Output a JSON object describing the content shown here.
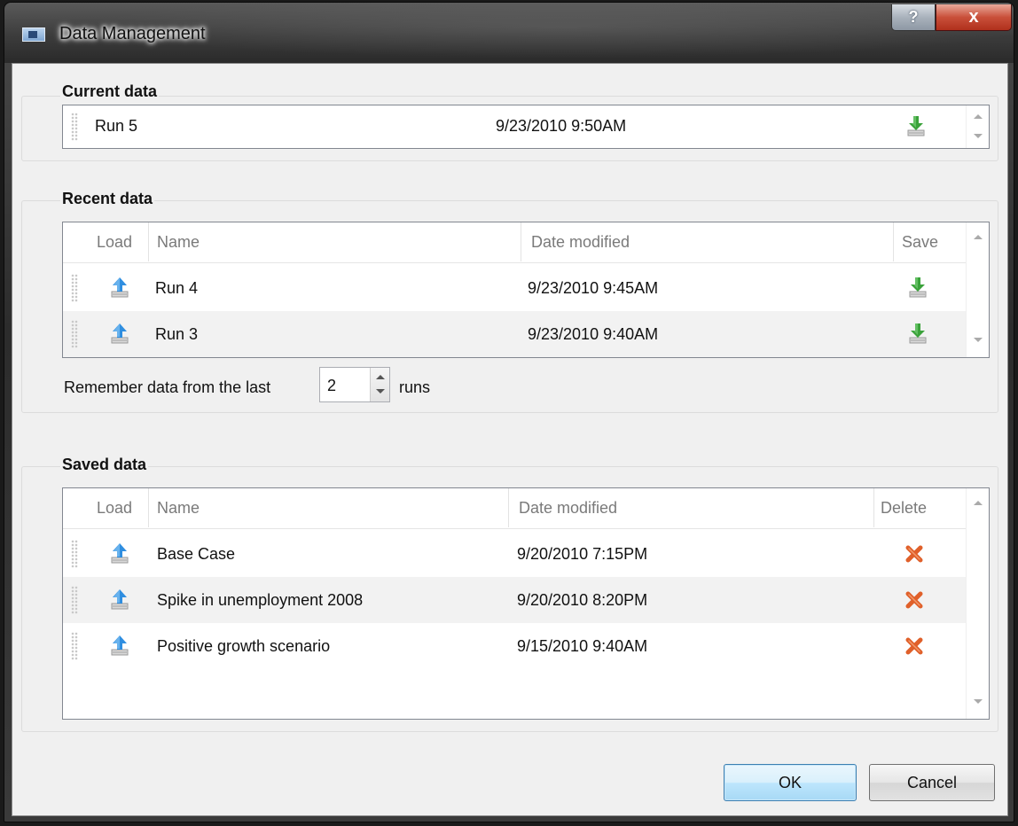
{
  "window": {
    "title": "Data Management",
    "help_glyph": "?",
    "close_glyph": "x"
  },
  "current": {
    "title": "Current data",
    "row": {
      "name": "Run 5",
      "date": "9/23/2010 9:50AM",
      "action_icon": "save-download-icon"
    }
  },
  "recent": {
    "title": "Recent data",
    "headers": {
      "load": "Load",
      "name": "Name",
      "date": "Date modified",
      "save": "Save"
    },
    "rows": [
      {
        "name": "Run 4",
        "date": "9/23/2010 9:45AM"
      },
      {
        "name": "Run 3",
        "date": "9/23/2010 9:40AM"
      }
    ],
    "remember_prefix": "Remember data from the last",
    "remember_value": "2",
    "remember_suffix": "runs"
  },
  "saved": {
    "title": "Saved data",
    "headers": {
      "load": "Load",
      "name": "Name",
      "date": "Date modified",
      "delete": "Delete"
    },
    "rows": [
      {
        "name": "Base Case",
        "date": "9/20/2010 7:15PM"
      },
      {
        "name": "Spike in unemployment 2008",
        "date": "9/20/2010 8:20PM"
      },
      {
        "name": "Positive growth scenario",
        "date": "9/15/2010 9:40AM"
      }
    ]
  },
  "buttons": {
    "ok": "OK",
    "cancel": "Cancel"
  },
  "colors": {
    "accent": "#3c7fb1",
    "delete": "#e0602a",
    "save": "#3aa23a",
    "load": "#2f8ee0"
  }
}
